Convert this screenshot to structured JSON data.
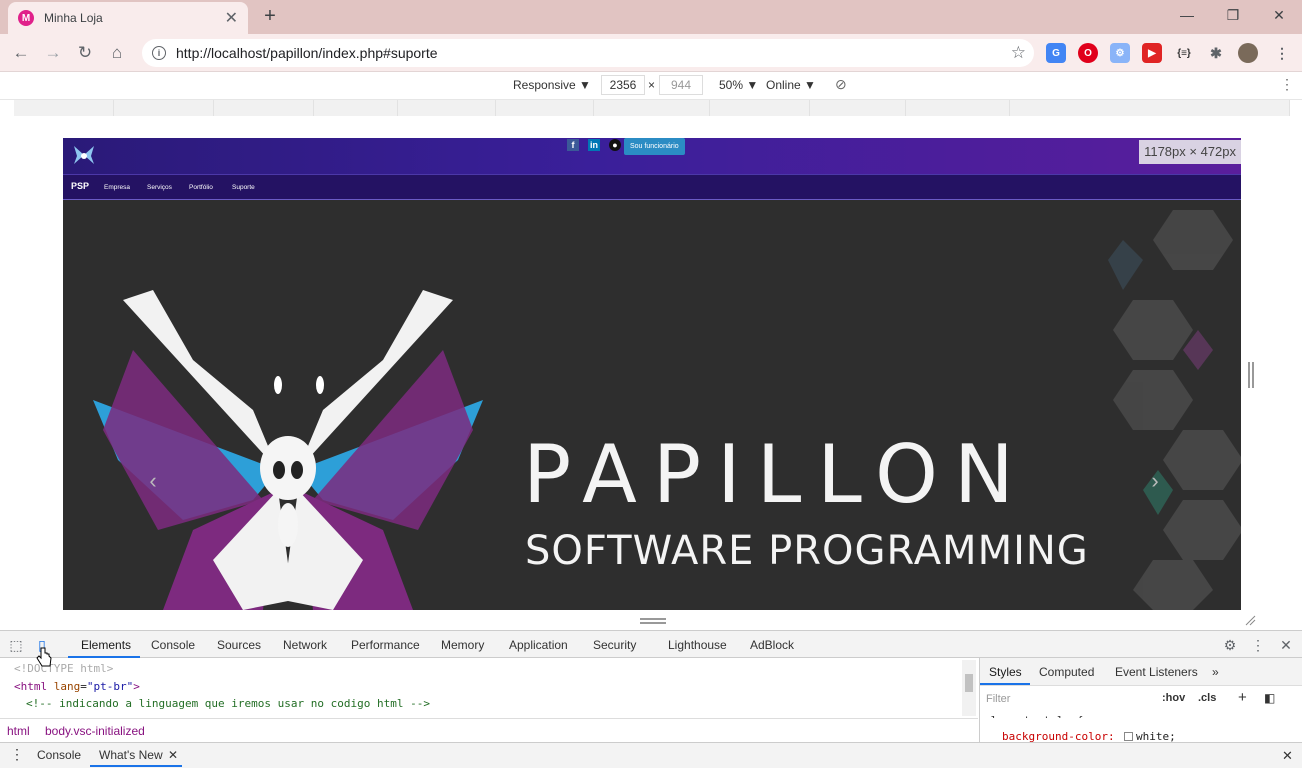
{
  "browser": {
    "tab_title": "Minha Loja",
    "tab_favicon": "M",
    "url": "http://localhost/papillon/index.php#suporte"
  },
  "device_toolbar": {
    "mode": "Responsive ▼",
    "width": "2356",
    "times": "×",
    "height": "944",
    "zoom": "50% ▼",
    "throttle": "Online ▼"
  },
  "site": {
    "size_label": "1178px × 472px",
    "staff_button": "Sou funcionário",
    "brand": "PSP",
    "nav": [
      "Empresa",
      "Serviços",
      "Portfólio",
      "Suporte"
    ],
    "hero_title": "PAPILLON",
    "hero_subtitle": "SOFTWARE PROGRAMMING",
    "social": [
      "f",
      "in"
    ]
  },
  "devtools": {
    "tabs": [
      "Elements",
      "Console",
      "Sources",
      "Network",
      "Performance",
      "Memory",
      "Application",
      "Security",
      "Lighthouse",
      "AdBlock"
    ],
    "code": {
      "doctype": "<!DOCTYPE html>",
      "html_open": "<html",
      "lang_attr": "lang",
      "lang_val": "\"pt-br\"",
      "html_close": ">",
      "comment": "<!-- indicando a linguagem que iremos usar no codigo html -->"
    },
    "styles_tabs": [
      "Styles",
      "Computed",
      "Event Listeners",
      "»"
    ],
    "filter_placeholder": "Filter",
    "hov": ":hov",
    "cls": ".cls",
    "element_style": "element.style {",
    "bg_prop": "background-color:",
    "bg_val": "white;",
    "breadcrumbs": [
      "html",
      "body.vsc-initialized"
    ],
    "drawer_tabs": [
      "Console",
      "What's New"
    ]
  }
}
